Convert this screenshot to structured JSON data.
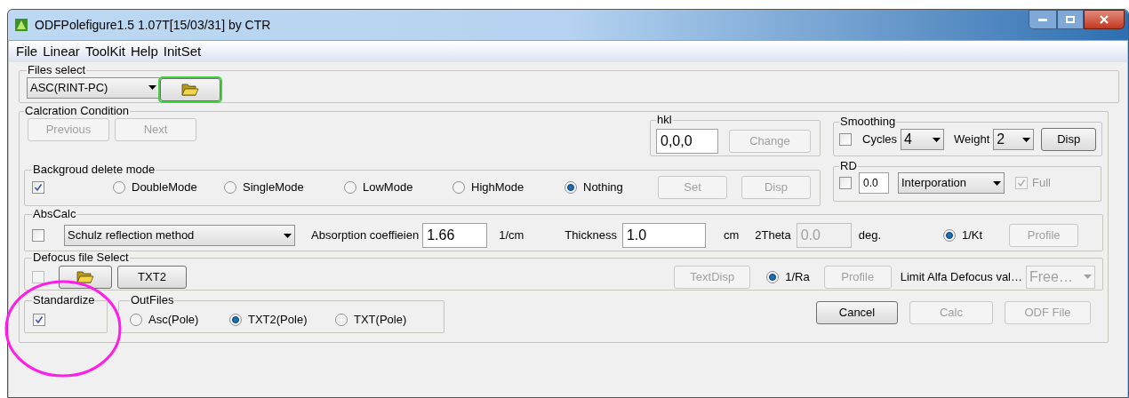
{
  "window": {
    "title": "ODFPolefigure1.5 1.07T[15/03/31] by CTR"
  },
  "menu": [
    "File",
    "Linear",
    "ToolKit",
    "Help",
    "InitSet"
  ],
  "files_select": {
    "legend": "Files select",
    "format": "ASC(RINT-PC)",
    "folder_focused": true
  },
  "calcration": {
    "legend": "Calcration Condition",
    "buttons": [
      {
        "label": "Previous",
        "disabled": true
      },
      {
        "label": "Next",
        "disabled": true
      }
    ]
  },
  "hkl": {
    "legend": "hkl",
    "value": "0,0,0",
    "button": {
      "label": "Change",
      "disabled": true
    }
  },
  "smoothing": {
    "legend": "Smoothing",
    "checked": false,
    "cycles_label": "Cycles",
    "cycles": "4",
    "weight_label": "Weight",
    "weight": "2",
    "button": {
      "label": "Disp",
      "disabled": false
    }
  },
  "background": {
    "legend": "Backgroud delete mode",
    "checked": true,
    "modes": [
      {
        "label": "DoubleMode",
        "selected": false
      },
      {
        "label": "SingleMode",
        "selected": false
      },
      {
        "label": "LowMode",
        "selected": false
      },
      {
        "label": "HighMode",
        "selected": false
      },
      {
        "label": "Nothing",
        "selected": true
      }
    ],
    "buttons": [
      {
        "label": "Set",
        "disabled": true
      },
      {
        "label": "Disp",
        "disabled": true
      }
    ]
  },
  "rd": {
    "legend": "RD",
    "checked": false,
    "value": "0.0",
    "method": "Interporation",
    "full": {
      "label": "Full",
      "checked": true,
      "disabled": true
    }
  },
  "abs_calc": {
    "legend": "AbsCalc",
    "checked": false,
    "method": "Schulz reflection method",
    "coef_label": "Absorption coeffieien",
    "coef": "1.66",
    "coef_unit": "1/cm",
    "thickness_label": "Thickness",
    "thickness": "1.0",
    "thickness_unit": "cm",
    "theta_label": "2Theta",
    "theta": "0.0",
    "theta_unit": "deg.",
    "kt": {
      "label": "1/Kt",
      "selected": true
    },
    "profile": {
      "label": "Profile",
      "disabled": true
    }
  },
  "defocus": {
    "legend": "Defocus file Select",
    "checked": false,
    "txt2": {
      "label": "TXT2",
      "disabled": false
    },
    "textdisp": {
      "label": "TextDisp",
      "disabled": true
    },
    "ra": {
      "label": "1/Ra",
      "selected": true
    },
    "profile": {
      "label": "Profile",
      "disabled": true
    },
    "limit_label": "Limit Alfa Defocus val…",
    "limit": "Free…"
  },
  "standardize": {
    "legend": "Standardize",
    "checked": true
  },
  "out_files": {
    "legend": "OutFiles",
    "options": [
      {
        "label": "Asc(Pole)",
        "selected": false
      },
      {
        "label": "TXT2(Pole)",
        "selected": true
      },
      {
        "label": "TXT(Pole)",
        "selected": false
      }
    ]
  },
  "actions": [
    {
      "label": "Cancel",
      "disabled": false
    },
    {
      "label": "Calc",
      "disabled": true
    },
    {
      "label": "ODF File",
      "disabled": true
    }
  ]
}
